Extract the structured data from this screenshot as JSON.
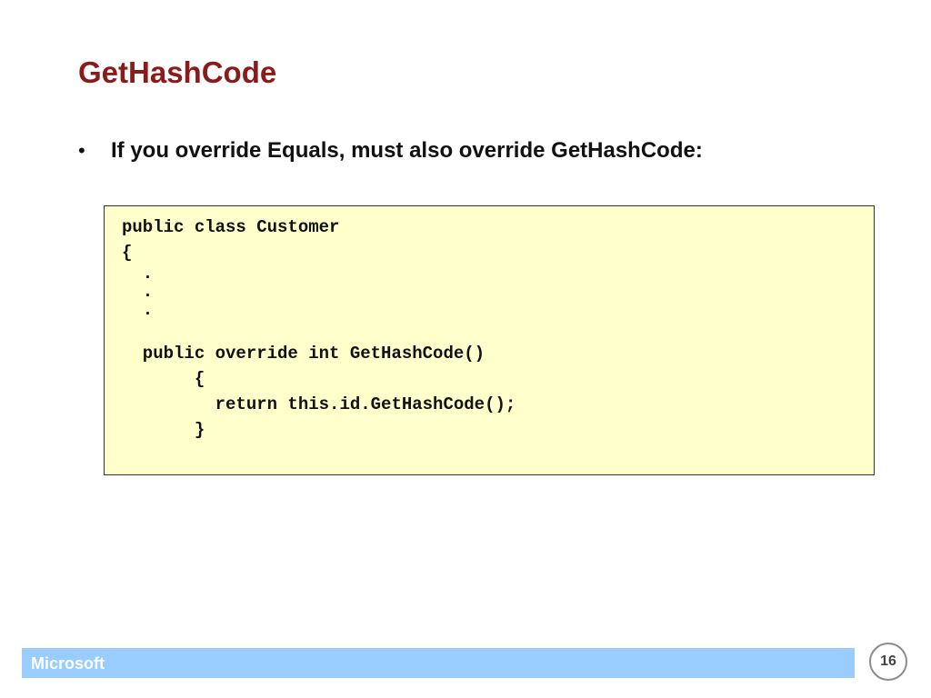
{
  "slide": {
    "title": "GetHashCode",
    "bullet_symbol": "•",
    "bullet_text": "If you override Equals, must also override GetHashCode:"
  },
  "code": {
    "lines": [
      "public class Customer",
      "{",
      "  .",
      "  .",
      "  .",
      "",
      "  public override int GetHashCode()",
      "       {",
      "         return this.id.GetHashCode();",
      "       }"
    ]
  },
  "footer": {
    "brand": "Microsoft",
    "page_number": "16"
  },
  "colors": {
    "title": "#8b1a1a",
    "code_background": "#ffffcc",
    "footer_bar": "#99ccff"
  }
}
